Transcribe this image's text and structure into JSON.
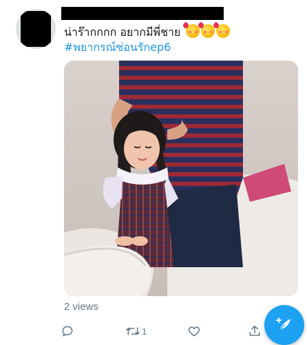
{
  "tweet": {
    "text": "น่าร๊ากกกก อยากมีพี่ชาย",
    "emojis": [
      "smiling-face-with-hearts",
      "smiling-face-with-hearts",
      "smiling-face-with-hearts"
    ],
    "hashtag": "#พยากรณ์ซ่อนรักep6",
    "views": "2 views"
  },
  "actions": {
    "retweet_count": "1"
  },
  "colors": {
    "link": "#1b95e0",
    "muted": "#657786",
    "fab": "#1da1f2"
  },
  "icons": {
    "reply": "speech-bubble-icon",
    "retweet": "retweet-icon",
    "like": "heart-icon",
    "share": "share-icon",
    "compose": "compose-feather-icon"
  }
}
